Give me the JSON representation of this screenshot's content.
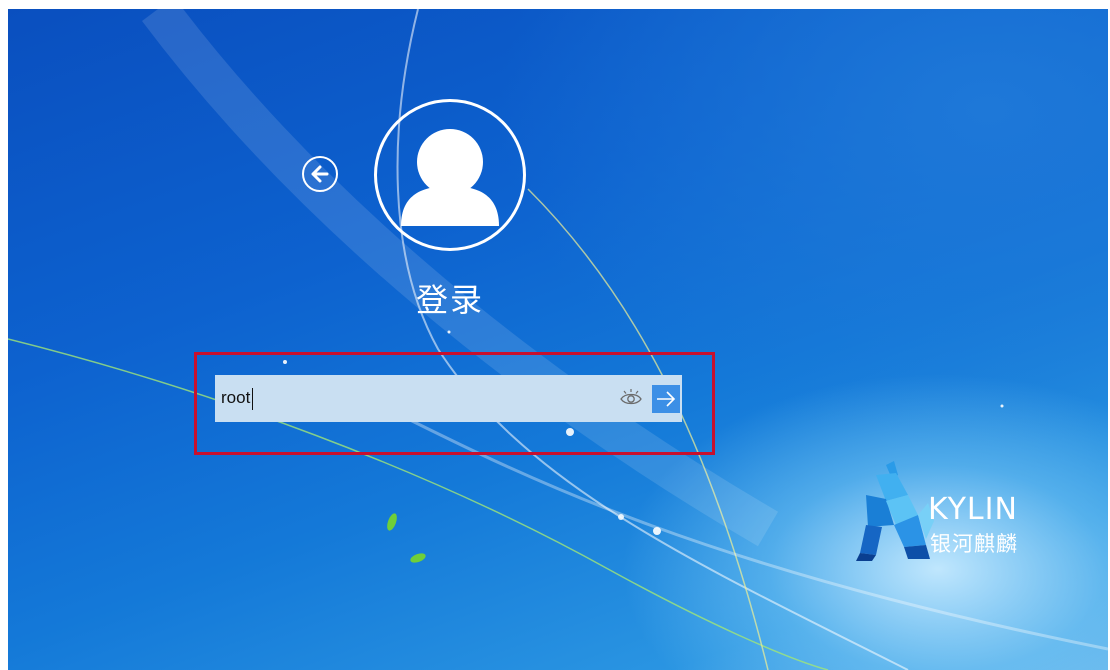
{
  "screen": {
    "title": "登录",
    "icons": {
      "back": "arrow-left-circle-icon",
      "avatar": "user-silhouette-icon",
      "reveal": "eye-icon",
      "submit": "arrow-right-icon"
    },
    "colors": {
      "background": "#0d62cf",
      "field_background": "#c9dff2",
      "submit_background": "#3c8fe6",
      "highlight_border": "#c8102e"
    }
  },
  "login_form": {
    "input_value": "root"
  },
  "logo": {
    "name": "KYLIN",
    "subtitle": "银河麒麟"
  }
}
